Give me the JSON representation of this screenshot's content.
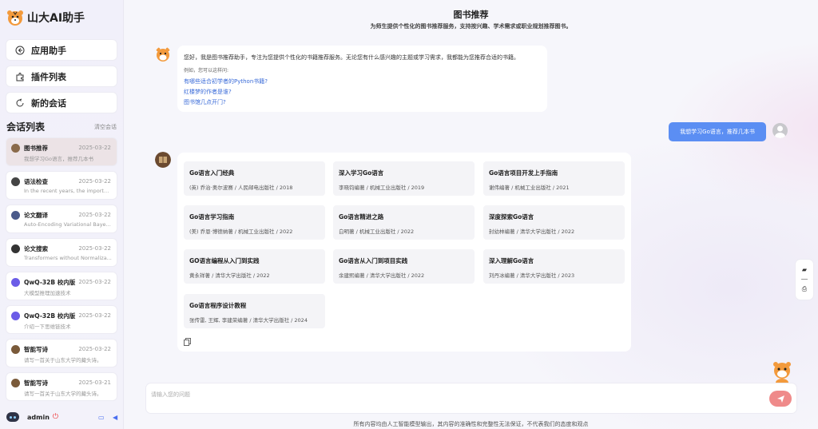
{
  "app": {
    "name": "山大AI助手"
  },
  "nav": {
    "apps": "应用助手",
    "plugins": "插件列表",
    "new_chat": "新的会话"
  },
  "sessions": {
    "title": "会话列表",
    "clear": "清空会话",
    "items": [
      {
        "title": "图书推荐",
        "date": "2025-03-22",
        "sub": "我想学习Go语言，推荐几本书"
      },
      {
        "title": "语法检查",
        "date": "2025-03-22",
        "sub": "In the recent years, the importa..."
      },
      {
        "title": "论文翻译",
        "date": "2025-03-22",
        "sub": "Auto-Encoding Variational Baye..."
      },
      {
        "title": "论文搜索",
        "date": "2025-03-22",
        "sub": "Transformers without Normaliza..."
      },
      {
        "title": "QwQ-32B 校内版",
        "date": "2025-03-22",
        "sub": "大模型推理加速技术"
      },
      {
        "title": "QwQ-32B 校内版",
        "date": "2025-03-22",
        "sub": "介绍一下思维链技术"
      },
      {
        "title": "智能写诗",
        "date": "2025-03-22",
        "sub": "请写一首关于山东大学的藏头诗。"
      },
      {
        "title": "智能写诗",
        "date": "2025-03-21",
        "sub": "请写一首关于山东大学的藏头诗。"
      }
    ]
  },
  "user": {
    "name": "admin"
  },
  "header": {
    "title": "图书推荐",
    "subtitle": "为师生提供个性化的图书推荐服务，支持按兴趣、学术需求或职业规划推荐图书。"
  },
  "welcome": {
    "intro": "您好，我是图书推荐助手，专注为您提供个性化的书籍推荐服务。无论您有什么感兴趣的主题或学习需求，我都能为您推荐合适的书籍。",
    "example_label": "例如，您可以这样问:",
    "questions": [
      "有哪些适合初学者的Python书籍?",
      "红楼梦的作者是谁?",
      "图书馆几点开门?"
    ]
  },
  "user_message": "我想学习Go语言，推荐几本书",
  "books": [
    {
      "title": "Go语言入门经典",
      "meta": "(英) 乔治·奥尔波赛 / 人民邮电出版社 / 2018"
    },
    {
      "title": "深入学习Go语言",
      "meta": "李晓钧编著 / 机械工业出版社 / 2019"
    },
    {
      "title": "Go语言项目开发上手指南",
      "meta": "谢伟编著 / 机械工业出版社 / 2021"
    },
    {
      "title": "Go语言学习指南",
      "meta": "(美) 乔恩·博德纳著 / 机械工业出版社 / 2022"
    },
    {
      "title": "Go语言精进之路",
      "meta": "白明著 / 机械工业出版社 / 2022"
    },
    {
      "title": "深度探索Go语言",
      "meta": "封幼林编著 / 清华大学出版社 / 2022"
    },
    {
      "title": "GO语言编程从入门到实践",
      "meta": "黄永祥著 / 清华大学出版社 / 2022"
    },
    {
      "title": "Go语言从入门到项目实践",
      "meta": "余建熙编著 / 清华大学出版社 / 2022"
    },
    {
      "title": "深入理解Go语言",
      "meta": "刘丹冰编著 / 清华大学出版社 / 2023"
    },
    {
      "title": "Go语言程序设计教程",
      "meta": "张传雷, 王辉, 李建荣编著 / 清华大学出版社 / 2024"
    }
  ],
  "input": {
    "placeholder": "请输入您的问题"
  },
  "disclaimer": "所有内容均由人工智能模型输出，其内容的准确性和完整性无法保证，不代表我们的态度和观点",
  "colors": {
    "primary": "#5b8ef3",
    "send": "#ef8a8a",
    "active_session": "#ece3e6"
  }
}
